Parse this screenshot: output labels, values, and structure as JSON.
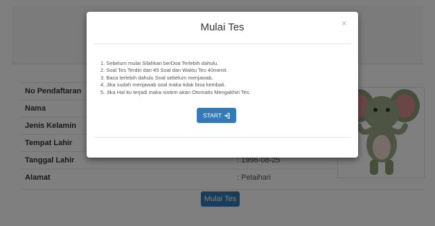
{
  "page": {
    "rows": [
      {
        "label": "No Pendaftaran",
        "value": ""
      },
      {
        "label": "Nama",
        "value": ""
      },
      {
        "label": "Jenis Kelamin",
        "value": ""
      },
      {
        "label": "Tempat Lahir",
        "value": ""
      },
      {
        "label": "Tanggal Lahir",
        "value": ": 1996-08-25"
      },
      {
        "label": "Alamat",
        "value": ": Pelaihari"
      }
    ],
    "start_button_label": "Mulai Tes"
  },
  "modal": {
    "title": "Mulai Tes",
    "close_symbol": "×",
    "instructions": [
      "1. Sebelum mulai Silahkan berDoa Terlebih dahulu.",
      "2. Soal Tes Terdiri dari 45 Soal dan Waktu Tes 40menit.",
      "3. Baca terlebih dahulu Soal sebelum menjawab.",
      "4. Jika sudah menjawab soal maka tidak bisa kembali.",
      "5. Jika Hal itu terjadi maka sistem akan Otomatis Mengakhiri Tes."
    ],
    "start_label": "START",
    "start_icon": "sign-in-icon"
  },
  "colors": {
    "primary": "#337ab7",
    "backdrop": "rgba(0,0,0,0.5)"
  }
}
